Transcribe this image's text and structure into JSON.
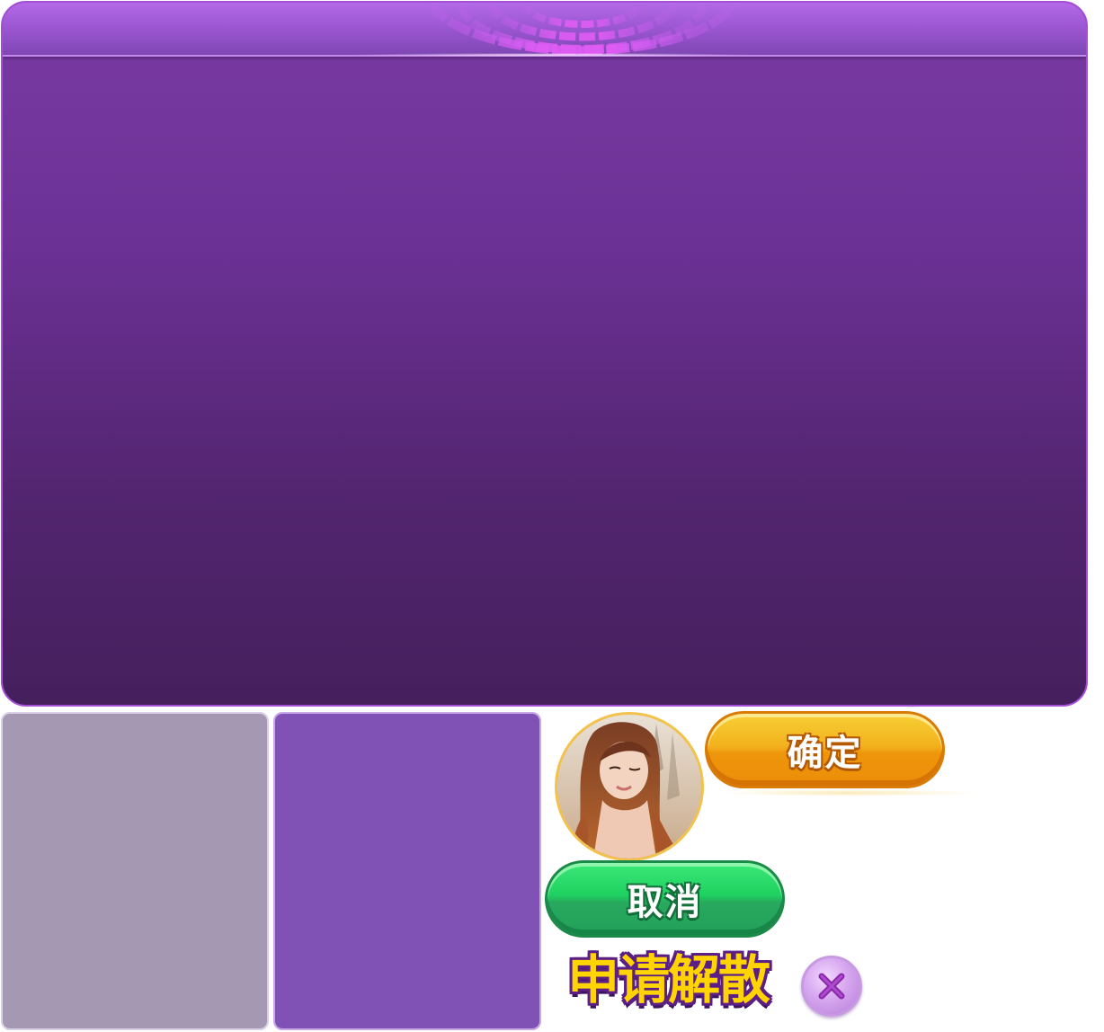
{
  "dialog": {
    "title_art": "申请解散"
  },
  "buttons": {
    "confirm_label": "确定",
    "cancel_label": "取消",
    "close_icon": "close-icon"
  },
  "swatches": [
    {
      "name": "grey-tile",
      "color": "#a498b3"
    },
    {
      "name": "purple-tile",
      "color": "#8152b6"
    }
  ],
  "colors": {
    "panel_top": "#7a3ba3",
    "panel_bottom": "#45205d",
    "header": "#9a56d0",
    "confirm": "#f2b21e",
    "cancel": "#1fd160",
    "title_fill": "#ffd400",
    "title_stroke": "#5b1f86"
  },
  "avatar": {
    "icon": "player-avatar-photo"
  }
}
